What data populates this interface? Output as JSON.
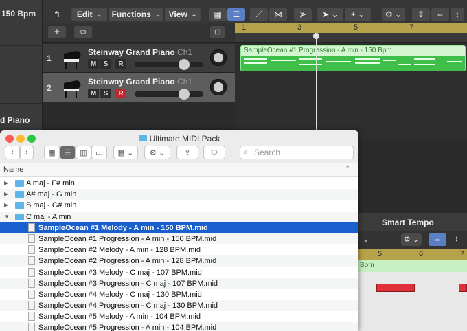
{
  "toolbar": {
    "tempo": "150 Bpm",
    "edit": "Edit",
    "functions": "Functions",
    "view": "View"
  },
  "tracks": [
    {
      "number": "1",
      "name": "Steinway Grand Piano",
      "channel": "Ch1",
      "m": "M",
      "s": "S",
      "r": "R"
    },
    {
      "number": "2",
      "name": "Steinway Grand Piano",
      "channel": "Ch1",
      "m": "M",
      "s": "S",
      "r": "R"
    }
  ],
  "left_label": "d Piano",
  "ruler": [
    "1",
    "3",
    "5",
    "7"
  ],
  "region": {
    "title": "SampleOcean #1 Progression - A min - 150 Bpm"
  },
  "bottom_panel": {
    "title": "Smart Tempo",
    "bpm": "Bpm",
    "bars": [
      "5",
      "6",
      "7"
    ]
  },
  "finder": {
    "title": "Ultimate MIDI Pack",
    "search_placeholder": "Search",
    "column": "Name",
    "rows": [
      {
        "type": "folder",
        "label": "A maj - F# min"
      },
      {
        "type": "folder",
        "label": "A# maj - G min"
      },
      {
        "type": "folder",
        "label": "B maj - G# min"
      },
      {
        "type": "folder-open",
        "label": "C maj - A min"
      },
      {
        "type": "file",
        "label": "SampleOcean #1 Melody - A min - 150 BPM.mid",
        "selected": true
      },
      {
        "type": "file",
        "label": "SampleOcean #1 Progression - A min - 150 BPM.mid"
      },
      {
        "type": "file",
        "label": "SampleOcean #2 Melody - A min - 128 BPM.mid"
      },
      {
        "type": "file",
        "label": "SampleOcean #2 Progression - A min - 128 BPM.mid"
      },
      {
        "type": "file",
        "label": "SampleOcean #3 Melody - C maj - 107 BPM.mid"
      },
      {
        "type": "file",
        "label": "SampleOcean #3 Progression - C maj - 107 BPM.mid"
      },
      {
        "type": "file",
        "label": "SampleOcean #4 Melody - C maj - 130 BPM.mid"
      },
      {
        "type": "file",
        "label": "SampleOcean #4 Progression - C maj - 130 BPM.mid"
      },
      {
        "type": "file",
        "label": "SampleOcean #5 Melody - A min - 104 BPM.mid"
      },
      {
        "type": "file",
        "label": "SampleOcean #5 Progression - A min - 104 BPM.mid"
      }
    ]
  }
}
